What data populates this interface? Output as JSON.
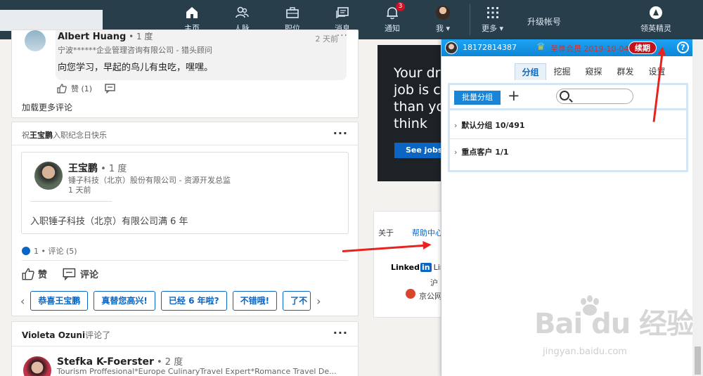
{
  "nav": {
    "items": [
      {
        "label": "主页",
        "icon": "home-icon"
      },
      {
        "label": "人脉",
        "icon": "network-icon"
      },
      {
        "label": "职位",
        "icon": "jobs-icon"
      },
      {
        "label": "消息",
        "icon": "messages-icon"
      },
      {
        "label": "通知",
        "icon": "bell-icon",
        "badge": "3"
      },
      {
        "label": "我 ▾",
        "icon": "avatar"
      },
      {
        "label": "更多 ▾",
        "icon": "grid-icon"
      }
    ],
    "upgrade": "升级帐号",
    "plugin_label": "领英精灵"
  },
  "comment": {
    "name": "Albert Huang",
    "degree": " • 1 度",
    "time": "2 天前",
    "company": "宁波******企业管理咨询有限公司 - 猎头顾问",
    "text": "向您学习，早起的鸟儿有虫吃，嘿嘿。",
    "like": "赞 (1)",
    "load_more": "加载更多评论"
  },
  "anniv": {
    "prefix": "祝",
    "name": "王宝鹏",
    "suffix": "入职纪念日快乐",
    "person_name": "王宝鹏",
    "person_degree": " • 1 度",
    "person_sub": "锤子科技（北京）股份有限公司 - 资源开发总监",
    "person_time": "1 天前",
    "text": "入职锤子科技（北京）有限公司满 6 年",
    "stats": "1 • 评论 (5)",
    "like": "赞",
    "comment": "评论",
    "chips": [
      "恭喜王宝鹏",
      "真替您高兴!",
      "已经 6 年啦?",
      "不错哦!",
      "了不"
    ]
  },
  "post3": {
    "actor": "Violeta Ozuni",
    "action": "评论了",
    "name": "Stefka K-Foerster",
    "degree": " • 2 度",
    "sub": "Tourism Proffesional*Europe CulinaryTravel Expert*Romance Travel De..."
  },
  "ad": {
    "text": "Your dr\njob is cl\nthan yo\nthink",
    "button": "See jobs"
  },
  "right": {
    "about": "关于",
    "help": "帮助中心",
    "brand": "Linked",
    "brand_in": "in",
    "brand_tail": "Link",
    "hu": "沪",
    "police": "京公网"
  },
  "plugin": {
    "phone": "18172814387",
    "vip": "至尊会员 2019-10-04",
    "renew": "续期",
    "help": "?",
    "tabs": [
      "分组",
      "挖掘",
      "窥探",
      "群发",
      "设置"
    ],
    "batch": "批量分组",
    "add": "+",
    "groups": [
      {
        "label": "默认分组 10/491"
      },
      {
        "label": "重点客户 1/1"
      }
    ]
  },
  "watermark": {
    "main": "Bai du 经验",
    "url": "jingyan.baidu.com"
  },
  "colors": {
    "nav_bg": "#283e4a",
    "accent": "#0a66c2",
    "arrow": "#e8231f",
    "plugin_header": "#1ea2f3"
  }
}
